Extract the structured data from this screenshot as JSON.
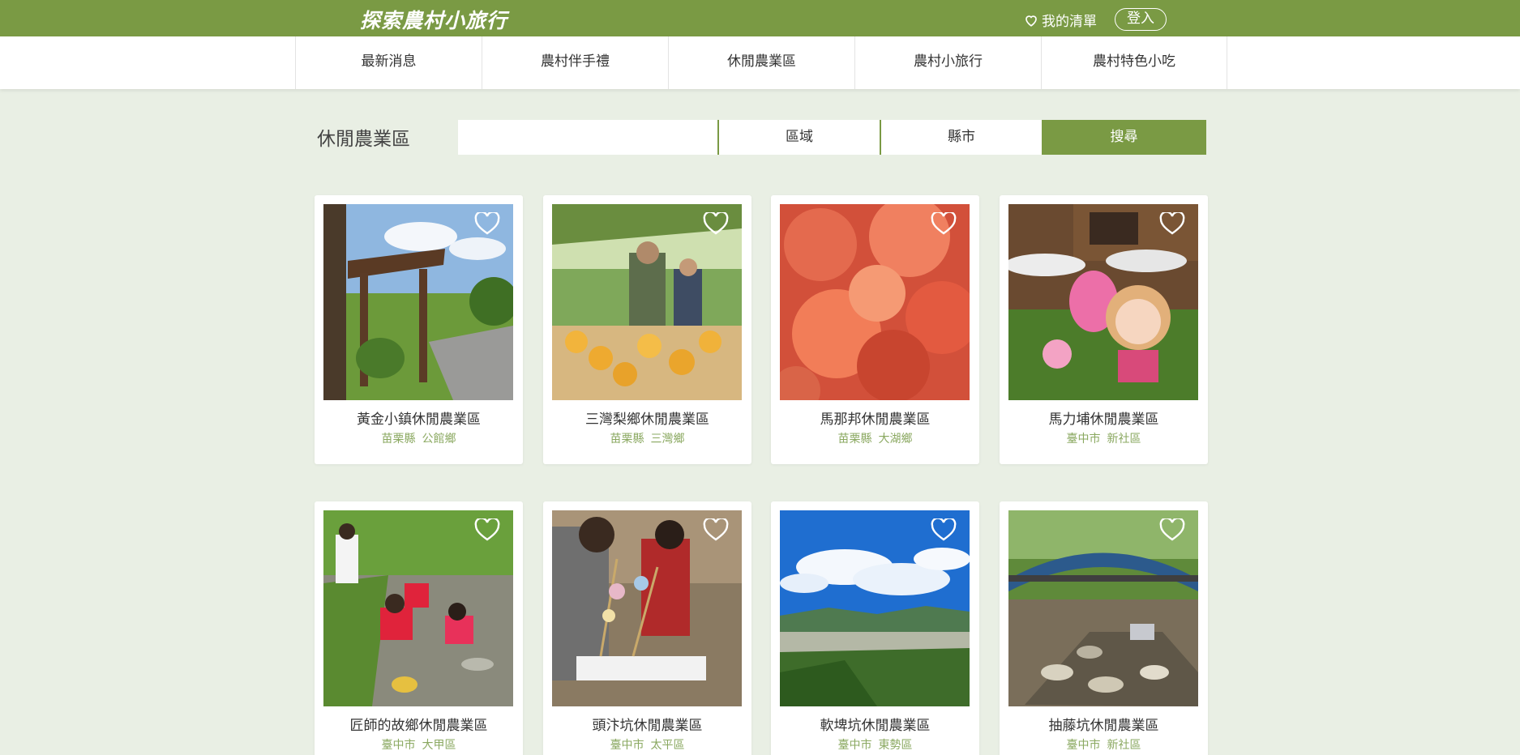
{
  "header": {
    "logo": "探索農村小旅行",
    "favorites_label": "我的清單",
    "login_label": "登入"
  },
  "nav": [
    "最新消息",
    "農村伴手禮",
    "休閒農業區",
    "農村小旅行",
    "農村特色小吃"
  ],
  "search": {
    "page_title": "休閒農業區",
    "input_value": "",
    "region_label": "區域",
    "county_label": "縣市",
    "button_label": "搜尋"
  },
  "cards": [
    {
      "name": "黃金小鎮休閒農業區",
      "county": "苗栗縣",
      "town": "公館鄉",
      "image": "garden-pavilion"
    },
    {
      "name": "三灣梨鄉休閒農業區",
      "county": "苗栗縣",
      "town": "三灣鄉",
      "image": "pear-harvest"
    },
    {
      "name": "馬那邦休閒農業區",
      "county": "苗栗縣",
      "town": "大湖鄉",
      "image": "red-maple"
    },
    {
      "name": "馬力埔休閒農業區",
      "county": "臺中市",
      "town": "新社區",
      "image": "plush-dolls"
    },
    {
      "name": "匠師的故鄉休閒農業區",
      "county": "臺中市",
      "town": "大甲區",
      "image": "kids-in-stream"
    },
    {
      "name": "頭汴坑休閒農業區",
      "county": "臺中市",
      "town": "太平區",
      "image": "bamboo-craft"
    },
    {
      "name": "軟埤坑休閒農業區",
      "county": "臺中市",
      "town": "東勢區",
      "image": "valley-sky"
    },
    {
      "name": "抽藤坑休閒農業區",
      "county": "臺中市",
      "town": "新社區",
      "image": "arch-bridge"
    }
  ],
  "colors": {
    "brand": "#7a9a44",
    "background": "#e9efe4",
    "location_text": "#8aa860"
  }
}
